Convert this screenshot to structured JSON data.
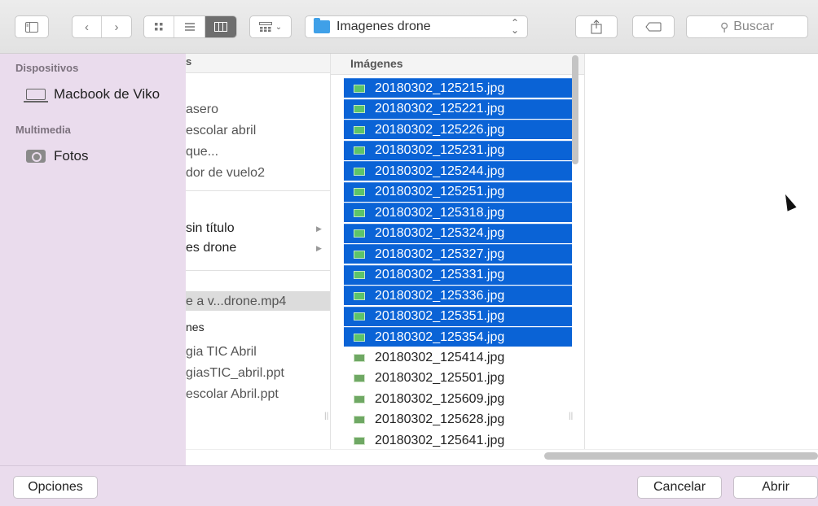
{
  "toolbar": {
    "path_folder": "Imagenes drone",
    "search_placeholder": "Buscar"
  },
  "sidebar": {
    "sections": [
      {
        "title": "Dispositivos",
        "items": [
          {
            "label": "Macbook de Viko",
            "icon": "laptop-icon"
          }
        ]
      },
      {
        "title": "Multimedia",
        "items": [
          {
            "label": "Fotos",
            "icon": "camera-icon"
          }
        ]
      }
    ]
  },
  "column1": {
    "header": "s",
    "items": [
      "asero",
      "escolar abril",
      "que...",
      "dor de vuelo2",
      "sin título",
      "es drone",
      "e a v...drone.mp4",
      "nes",
      "gia TIC Abril",
      "giasTIC_abril.ppt",
      "escolar Abril.ppt"
    ],
    "selected": "es drone"
  },
  "column2": {
    "header": "Imágenes",
    "files": [
      {
        "name": "20180302_125215.jpg",
        "selected": true
      },
      {
        "name": "20180302_125221.jpg",
        "selected": true
      },
      {
        "name": "20180302_125226.jpg",
        "selected": true
      },
      {
        "name": "20180302_125231.jpg",
        "selected": true
      },
      {
        "name": "20180302_125244.jpg",
        "selected": true
      },
      {
        "name": "20180302_125251.jpg",
        "selected": true
      },
      {
        "name": "20180302_125318.jpg",
        "selected": true
      },
      {
        "name": "20180302_125324.jpg",
        "selected": true
      },
      {
        "name": "20180302_125327.jpg",
        "selected": true
      },
      {
        "name": "20180302_125331.jpg",
        "selected": true
      },
      {
        "name": "20180302_125336.jpg",
        "selected": true
      },
      {
        "name": "20180302_125351.jpg",
        "selected": true
      },
      {
        "name": "20180302_125354.jpg",
        "selected": true
      },
      {
        "name": "20180302_125414.jpg",
        "selected": false
      },
      {
        "name": "20180302_125501.jpg",
        "selected": false
      },
      {
        "name": "20180302_125609.jpg",
        "selected": false
      },
      {
        "name": "20180302_125628.jpg",
        "selected": false
      },
      {
        "name": "20180302_125641.jpg",
        "selected": false
      }
    ]
  },
  "footer": {
    "options_label": "Opciones",
    "cancel_label": "Cancelar",
    "open_label": "Abrir"
  },
  "colors": {
    "selection": "#0a63d6",
    "sidebar_bg": "#eadced",
    "folder": "#3fa0e8"
  }
}
